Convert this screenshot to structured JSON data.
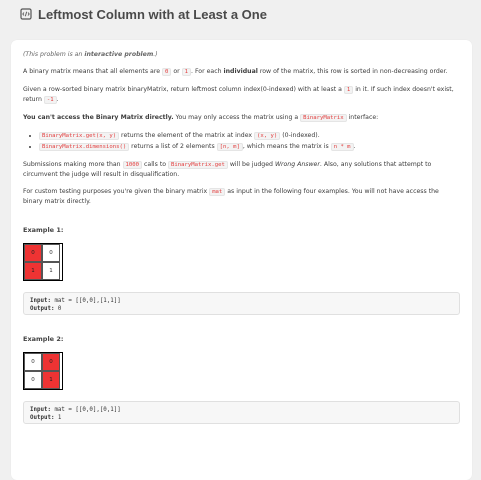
{
  "title": "Leftmost Column with at Least a One",
  "intro": {
    "interactive_prefix": "(This problem is an ",
    "interactive_bold": "interactive problem",
    "interactive_suffix": ".)"
  },
  "p1": {
    "a": "A binary matrix means that all elements are ",
    "c1": "0",
    "b": " or ",
    "c2": "1",
    "c": ". For each ",
    "bold": "individual",
    "d": " row of the matrix, this row is sorted in non-decreasing order."
  },
  "p2": {
    "a": "Given a row-sorted binary matrix binaryMatrix, return leftmost column index(0-indexed) with at least a ",
    "c1": "1",
    "b": " in it. If such index doesn't exist, return ",
    "c2": "-1",
    "c": "."
  },
  "p3": {
    "bold": "You can't access the Binary Matrix directly.",
    "a": "  You may only access the matrix using a ",
    "c1": "BinaryMatrix",
    "b": " interface:"
  },
  "bullets": [
    {
      "code": "BinaryMatrix.get(x, y)",
      "a": " returns the element of the matrix at index ",
      "code2": "(x, y)",
      "b": " (0-indexed)."
    },
    {
      "code": "BinaryMatrix.dimensions()",
      "a": " returns a list of 2 elements ",
      "code2": "[n, m]",
      "b": ", which means the matrix is ",
      "code3": "n * m",
      "c": "."
    }
  ],
  "p4": {
    "a": "Submissions making more than ",
    "c1": "1000",
    "b": " calls to ",
    "c2": "BinaryMatrix.get",
    "c": " will be judged ",
    "it": "Wrong Answer",
    "d": ".  Also, any solutions that attempt to circumvent the judge will result in disqualification."
  },
  "p5": {
    "a": "For custom testing purposes you're given the binary matrix ",
    "c1": "mat",
    "b": " as input in the following four examples. You will not have access the binary matrix directly."
  },
  "examples": [
    {
      "title": "Example 1:",
      "cells": [
        "0",
        "0",
        "1",
        "1"
      ],
      "input_label": "Input:",
      "input_value": " mat = [[0,0],[1,1]]",
      "output_label": "Output:",
      "output_value": " 0"
    },
    {
      "title": "Example 2:",
      "cells": [
        "0",
        "0",
        "0",
        "1"
      ],
      "input_label": "Input:",
      "input_value": " mat = [[0,0],[0,1]]",
      "output_label": "Output:",
      "output_value": " 1"
    }
  ],
  "colors": {
    "highlight_red": "#ee3333",
    "code_text": "#e23c3c"
  }
}
